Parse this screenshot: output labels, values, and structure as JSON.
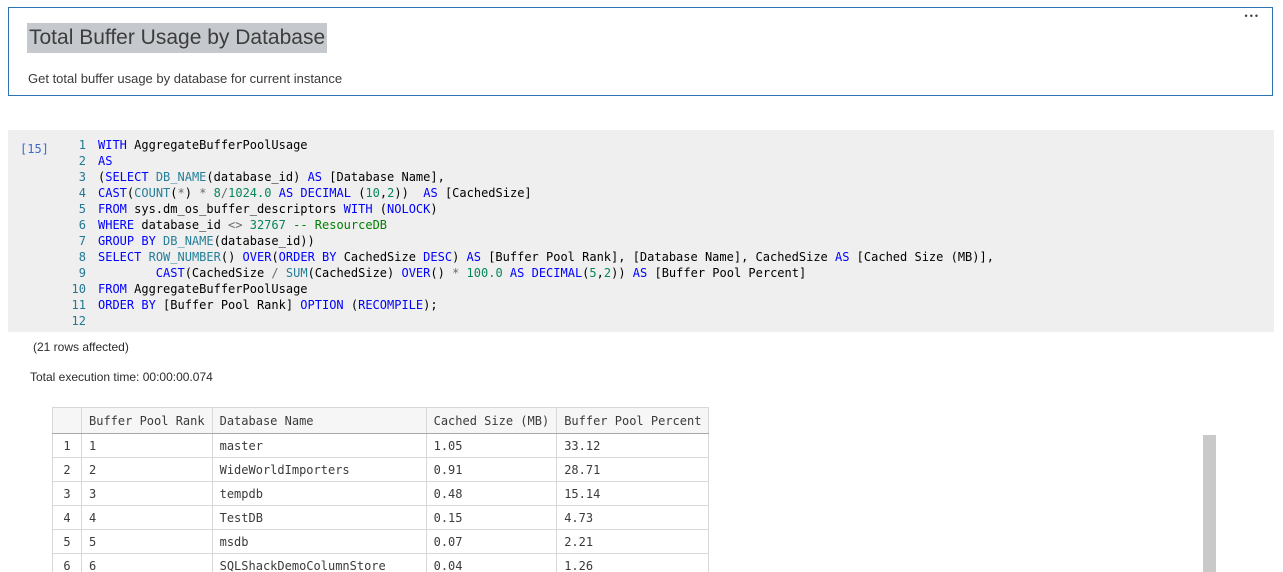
{
  "colors": {
    "accent": "#2e75b5",
    "selection": "#c5c9cd",
    "execcount": "#3c6bc9",
    "linenum": "#237893",
    "kw": "#0000ff",
    "fn": "#267f99",
    "num": "#098658",
    "cm": "#008000",
    "op": "#696969"
  },
  "header": {
    "title": "Total Buffer Usage by Database",
    "subtitle": "Get total buffer usage by database for current instance",
    "more_label": "•••"
  },
  "code_cell": {
    "execution_count": "[15]",
    "language": "sql",
    "lines": [
      {
        "n": "1",
        "tokens": [
          [
            "kw",
            "WITH"
          ],
          [
            "pl",
            " AggregateBufferPoolUsage"
          ]
        ]
      },
      {
        "n": "2",
        "tokens": [
          [
            "kw",
            "AS"
          ]
        ]
      },
      {
        "n": "3",
        "tokens": [
          [
            "pl",
            "("
          ],
          [
            "kw",
            "SELECT"
          ],
          [
            "pl",
            " "
          ],
          [
            "fn",
            "DB_NAME"
          ],
          [
            "pl",
            "(database_id) "
          ],
          [
            "kw",
            "AS"
          ],
          [
            "pl",
            " [Database Name],"
          ]
        ]
      },
      {
        "n": "4",
        "tokens": [
          [
            "kw",
            "CAST"
          ],
          [
            "pl",
            "("
          ],
          [
            "fn",
            "COUNT"
          ],
          [
            "pl",
            "("
          ],
          [
            "op",
            "*"
          ],
          [
            "pl",
            ") "
          ],
          [
            "op",
            "*"
          ],
          [
            "pl",
            " "
          ],
          [
            "num",
            "8"
          ],
          [
            "op",
            "/"
          ],
          [
            "num",
            "1024.0"
          ],
          [
            "pl",
            " "
          ],
          [
            "kw",
            "AS"
          ],
          [
            "pl",
            " "
          ],
          [
            "kw",
            "DECIMAL"
          ],
          [
            "pl",
            " ("
          ],
          [
            "num",
            "10"
          ],
          [
            "pl",
            ","
          ],
          [
            "num",
            "2"
          ],
          [
            "pl",
            "))  "
          ],
          [
            "kw",
            "AS"
          ],
          [
            "pl",
            " [CachedSize]"
          ]
        ]
      },
      {
        "n": "5",
        "tokens": [
          [
            "kw",
            "FROM"
          ],
          [
            "pl",
            " sys.dm_os_buffer_descriptors "
          ],
          [
            "kw",
            "WITH"
          ],
          [
            "pl",
            " ("
          ],
          [
            "kw",
            "NOLOCK"
          ],
          [
            "pl",
            ")"
          ]
        ]
      },
      {
        "n": "6",
        "tokens": [
          [
            "kw",
            "WHERE"
          ],
          [
            "pl",
            " database_id "
          ],
          [
            "op",
            "<>"
          ],
          [
            "pl",
            " "
          ],
          [
            "num",
            "32767"
          ],
          [
            "pl",
            " "
          ],
          [
            "cm",
            "-- ResourceDB"
          ]
        ]
      },
      {
        "n": "7",
        "tokens": [
          [
            "kw",
            "GROUP BY"
          ],
          [
            "pl",
            " "
          ],
          [
            "fn",
            "DB_NAME"
          ],
          [
            "pl",
            "(database_id))"
          ]
        ]
      },
      {
        "n": "8",
        "tokens": [
          [
            "kw",
            "SELECT"
          ],
          [
            "pl",
            " "
          ],
          [
            "fn",
            "ROW_NUMBER"
          ],
          [
            "pl",
            "() "
          ],
          [
            "kw",
            "OVER"
          ],
          [
            "pl",
            "("
          ],
          [
            "kw",
            "ORDER BY"
          ],
          [
            "pl",
            " CachedSize "
          ],
          [
            "kw",
            "DESC"
          ],
          [
            "pl",
            ") "
          ],
          [
            "kw",
            "AS"
          ],
          [
            "pl",
            " [Buffer Pool Rank], [Database Name], CachedSize "
          ],
          [
            "kw",
            "AS"
          ],
          [
            "pl",
            " [Cached Size (MB)],"
          ]
        ]
      },
      {
        "n": "9",
        "tokens": [
          [
            "pl",
            "        "
          ],
          [
            "kw",
            "CAST"
          ],
          [
            "pl",
            "(CachedSize "
          ],
          [
            "op",
            "/"
          ],
          [
            "pl",
            " "
          ],
          [
            "fn",
            "SUM"
          ],
          [
            "pl",
            "(CachedSize) "
          ],
          [
            "kw",
            "OVER"
          ],
          [
            "pl",
            "() "
          ],
          [
            "op",
            "*"
          ],
          [
            "pl",
            " "
          ],
          [
            "num",
            "100.0"
          ],
          [
            "pl",
            " "
          ],
          [
            "kw",
            "AS"
          ],
          [
            "pl",
            " "
          ],
          [
            "kw",
            "DECIMAL"
          ],
          [
            "pl",
            "("
          ],
          [
            "num",
            "5"
          ],
          [
            "pl",
            ","
          ],
          [
            "num",
            "2"
          ],
          [
            "pl",
            ")) "
          ],
          [
            "kw",
            "AS"
          ],
          [
            "pl",
            " [Buffer Pool Percent]"
          ]
        ]
      },
      {
        "n": "10",
        "tokens": [
          [
            "kw",
            "FROM"
          ],
          [
            "pl",
            " AggregateBufferPoolUsage"
          ]
        ]
      },
      {
        "n": "11",
        "tokens": [
          [
            "kw",
            "ORDER BY"
          ],
          [
            "pl",
            " [Buffer Pool Rank] "
          ],
          [
            "kw",
            "OPTION"
          ],
          [
            "pl",
            " ("
          ],
          [
            "kw",
            "RECOMPILE"
          ],
          [
            "pl",
            ");"
          ]
        ]
      },
      {
        "n": "12",
        "tokens": []
      }
    ]
  },
  "messages": {
    "rows_affected": "(21 rows affected)",
    "execution_time": "Total execution time: 00:00:00.074"
  },
  "results_table": {
    "columns": [
      "",
      "Buffer Pool Rank",
      "Database Name",
      "Cached Size (MB)",
      "Buffer Pool Percent"
    ],
    "rows": [
      [
        "1",
        "1",
        "master",
        "1.05",
        "33.12"
      ],
      [
        "2",
        "2",
        "WideWorldImporters",
        "0.91",
        "28.71"
      ],
      [
        "3",
        "3",
        "tempdb",
        "0.48",
        "15.14"
      ],
      [
        "4",
        "4",
        "TestDB",
        "0.15",
        "4.73"
      ],
      [
        "5",
        "5",
        "msdb",
        "0.07",
        "2.21"
      ],
      [
        "6",
        "6",
        "SQLShackDemoColumnStore",
        "0.04",
        "1.26"
      ]
    ]
  }
}
